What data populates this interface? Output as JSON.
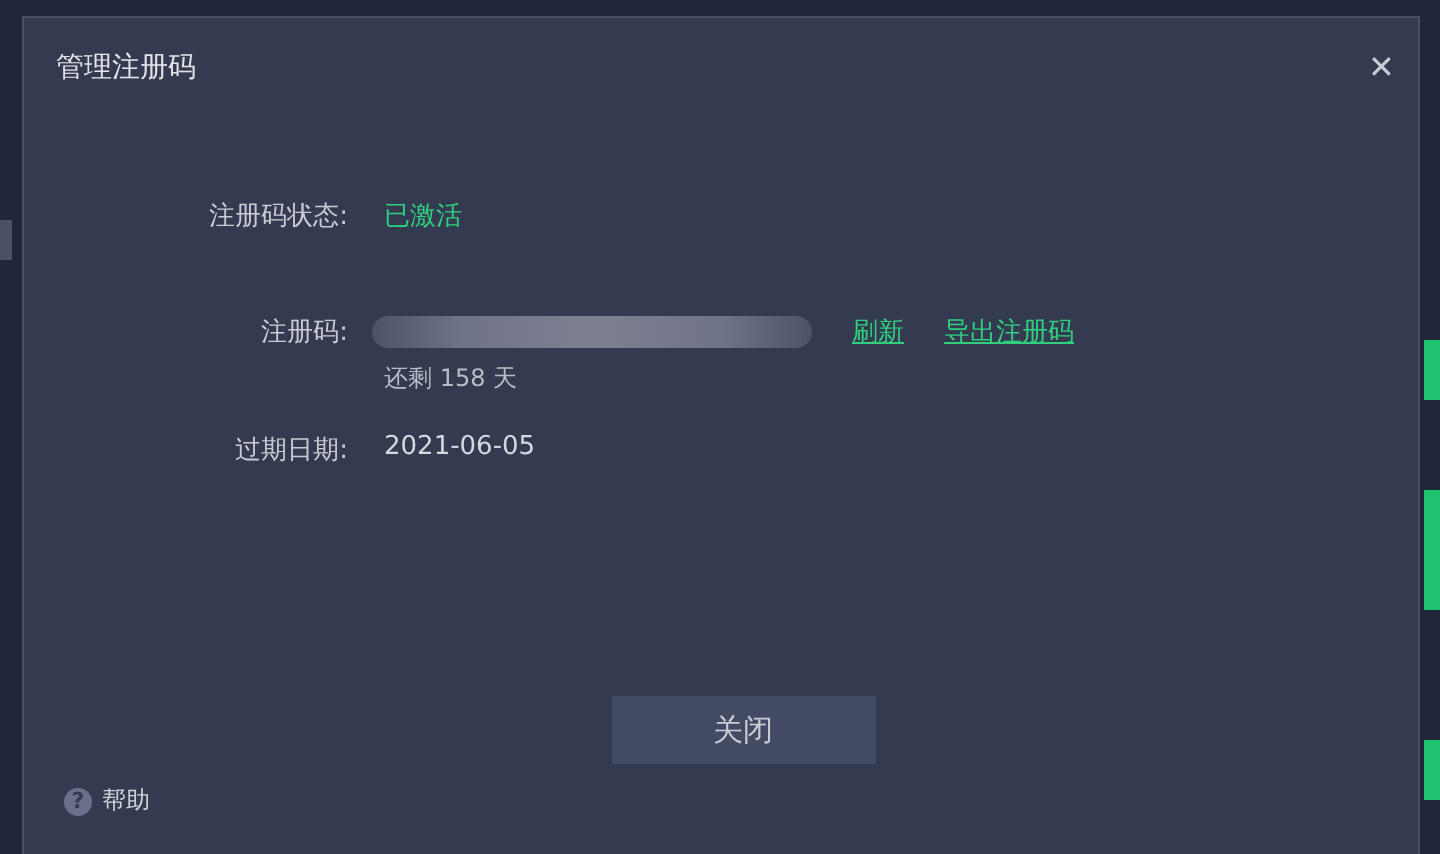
{
  "dialog": {
    "title": "管理注册码",
    "close_glyph": "✕",
    "status": {
      "label": "注册码状态:",
      "value": "已激活"
    },
    "code": {
      "label": "注册码:",
      "links": [
        "刷新",
        "导出注册码"
      ],
      "remaining": "还剩 158 天"
    },
    "expiry": {
      "label": "过期日期:",
      "value": "2021-06-05"
    },
    "close_button": "关闭",
    "help": {
      "glyph": "?",
      "label": "帮助"
    }
  }
}
